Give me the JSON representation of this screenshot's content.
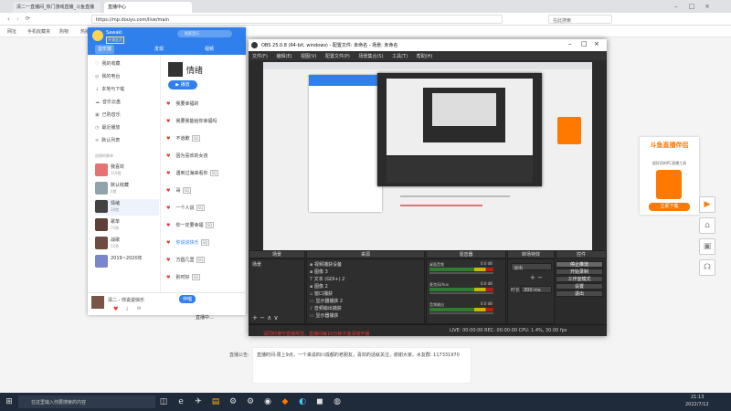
{
  "browser": {
    "tabs": [
      {
        "label": "清二一直播间_热门游戏直播_斗鱼直播"
      },
      {
        "label": "直播中心"
      }
    ],
    "url": "https://mp.douyu.com/live/main",
    "search_label": "在此搜索",
    "bookmarks": [
      "网址",
      "手机收藏夹",
      "购物",
      "热播剧"
    ]
  },
  "music_app": {
    "user": "Sawaki",
    "badge": "开通会员",
    "search_placeholder": "搜索音乐",
    "nav": [
      "音乐馆",
      "发现",
      "视频"
    ],
    "sidebar": [
      "我的收藏",
      "我的电台",
      "本地与下载",
      "音乐云盘",
      "已购音乐",
      "最近播放",
      "默认列表"
    ],
    "created_header": "创建的歌单",
    "playlists": [
      {
        "title": "我喜欢",
        "count": "119首"
      },
      {
        "title": "默认收藏",
        "count": "0首"
      },
      {
        "title": "情绪",
        "count": "28首"
      },
      {
        "title": "歌单",
        "count": "75首"
      },
      {
        "title": "战歌",
        "count": "52首"
      },
      {
        "title": "2019~2020年",
        "count": ""
      }
    ],
    "playlist_title": "情绪",
    "play_all": "播放",
    "songs": [
      "我要幸福的",
      "我要我能给你幸福吗",
      "不道歉",
      "因为喜欢的女孩",
      "遇到过海来看你",
      "哥",
      "一个人说",
      "你一定要幸福",
      "你说说快乐",
      "方圆几里",
      "别时好",
      "直播中..."
    ],
    "now_playing": "清二 - 你说说快乐",
    "player_tag": "伴唱"
  },
  "obs": {
    "title": "OBS 25.0.8 (64-bit, windows) - 配置文件: 未命名 - 场景: 未命名",
    "menu": [
      "文件(F)",
      "编辑(E)",
      "视图(V)",
      "配置文件(P)",
      "场景集合(S)",
      "工具(T)",
      "帮助(H)"
    ],
    "dock_titles": [
      "场景",
      "来源",
      "混音器",
      "转场特效",
      "控件"
    ],
    "scene": "场景",
    "sources": [
      "视频捕获设备",
      "图像 3",
      "文本 (GDI+) 2",
      "图像 2",
      "窗口捕获",
      "显示器捕获 2",
      "音频输出捕获",
      "显示器捕获"
    ],
    "mixer": [
      {
        "name": "桌面音频",
        "db": "0.0 dB"
      },
      {
        "name": "麦克风/Aux",
        "db": "0.0 dB"
      },
      {
        "name": "音频输出",
        "db": "0.0 dB"
      }
    ],
    "transition": "淡出",
    "duration_label": "时长",
    "duration": "300 ms",
    "controls": [
      "停止推流",
      "开始录制",
      "工作室模式",
      "设置",
      "退出"
    ],
    "status": "LIVE: 00:00:00  REC: 00:00:00  CPU: 1.4%, 30.00 fps"
  },
  "page": {
    "promo_title": "斗鱼直播伴侣",
    "promo_text": "超好用的PC直播工具",
    "promo_button": "立即下载",
    "notice_label": "直播公告:",
    "notice_text": "直播时间:周上9点，一个来说四川成都的老朋友，喜欢的话就关注，谢谢大家。水友群: 117331970",
    "red_tip": "请同时遵守直播规范，直播间每10分钟才能添加开播",
    "live_tag": "直播中..."
  },
  "taskbar": {
    "search_placeholder": "在这里输入你要搜索的内容",
    "time": "21:13",
    "date": "2022/7/12"
  },
  "colors": {
    "accent": "#2f80ed",
    "douyu": "#ff7800",
    "taskbar": "#1f2a3a"
  }
}
